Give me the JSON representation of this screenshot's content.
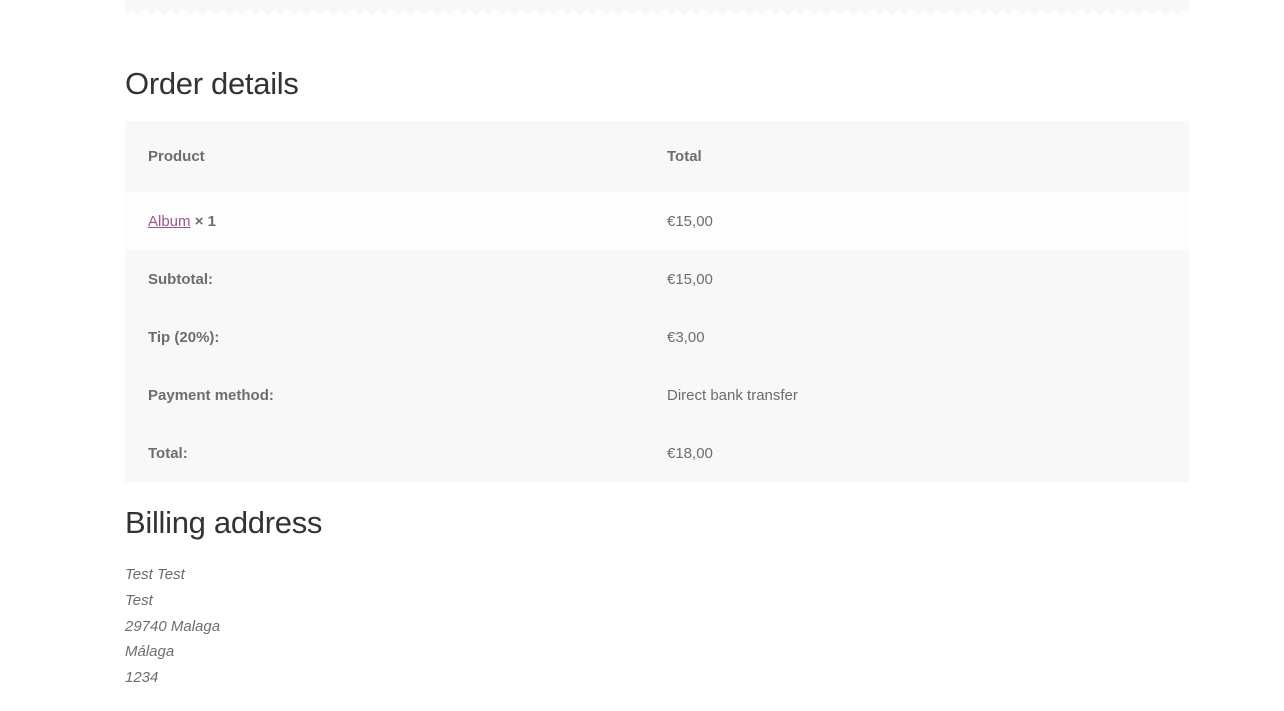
{
  "order_details": {
    "title": "Order details",
    "headers": {
      "product": "Product",
      "total": "Total"
    },
    "item": {
      "product_name": "Album",
      "quantity": "× 1",
      "total": "€15,00"
    },
    "rows": [
      {
        "label": "Subtotal:",
        "value": "€15,00"
      },
      {
        "label": "Tip (20%):",
        "value": "€3,00"
      },
      {
        "label": "Payment method:",
        "value": "Direct bank transfer"
      },
      {
        "label": "Total:",
        "value": "€18,00"
      }
    ]
  },
  "billing": {
    "title": "Billing address",
    "lines": [
      "Test Test",
      "Test",
      "29740 Malaga",
      "Málaga",
      "1234"
    ]
  },
  "colors": {
    "link": "#96588a",
    "text": "#6d6d6d",
    "heading": "#333333",
    "table_bg": "#f8f8f8"
  }
}
